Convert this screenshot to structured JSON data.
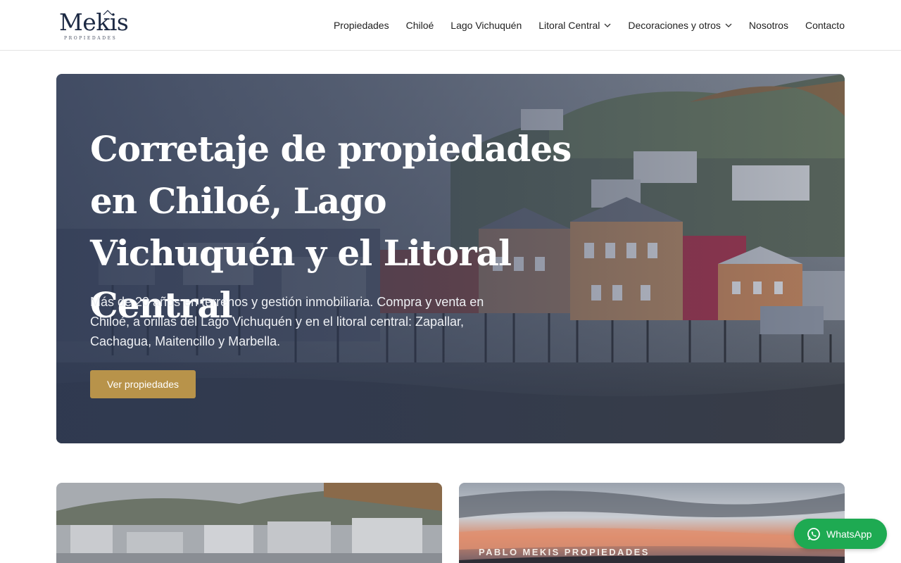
{
  "logo": {
    "word": "Mekis",
    "subtitle": "PROPIEDADES"
  },
  "nav": {
    "items": [
      {
        "label": "Propiedades",
        "has_dropdown": false
      },
      {
        "label": "Chiloé",
        "has_dropdown": false
      },
      {
        "label": "Lago Vichuquén",
        "has_dropdown": false
      },
      {
        "label": "Litoral Central",
        "has_dropdown": true
      },
      {
        "label": "Decoraciones y otros",
        "has_dropdown": true
      },
      {
        "label": "Nosotros",
        "has_dropdown": false
      },
      {
        "label": "Contacto",
        "has_dropdown": false
      }
    ]
  },
  "hero": {
    "title": "Corretaje de propiedades en Chiloé, Lago Vichuquén y el Litoral Central",
    "text": "Más de 20 años en terrenos y gestión inmobiliaria. Compra y venta en Chiloé, a orillas del Lago Vichuquén y en el litoral central: Zapallar, Cachagua, Maitencillo y Marbella.",
    "button_label": "Ver propiedades"
  },
  "cards": {
    "right_caption": "PABLO MEKIS PROPIEDADES"
  },
  "whatsapp": {
    "label": "WhatsApp"
  },
  "colors": {
    "accent_button": "#b8934a",
    "whatsapp_green": "#1eaa52",
    "logo_navy": "#1d2a44"
  }
}
